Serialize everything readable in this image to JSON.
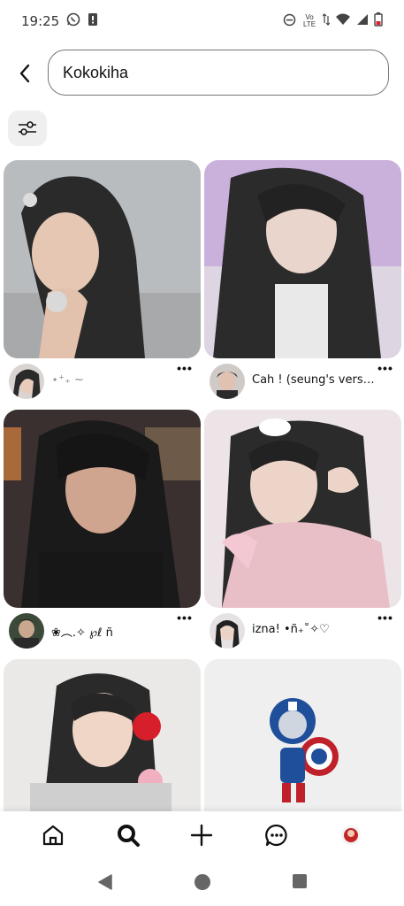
{
  "status_bar": {
    "time": "19:25",
    "network_label": "Vo LTE"
  },
  "search": {
    "value": "Kokokiha"
  },
  "pins": [
    {
      "caption": "⋆⁺₊ ~",
      "colors": [
        "#b7babd",
        "#2b2b2b"
      ]
    },
    {
      "caption": "Cah ! (seung's versio...",
      "colors": [
        "#cbb3dd",
        "#2a2a2a"
      ]
    },
    {
      "caption": "❀︵.✧ ℘ℓ ñ",
      "colors": [
        "#3a3030",
        "#1a1a1a"
      ]
    },
    {
      "caption": "izna! •ñ₊˚✧♡",
      "colors": [
        "#f0e6ea",
        "#2b2b2b"
      ]
    },
    {
      "caption": "",
      "colors": [
        "#e8e6e4",
        "#2a2a2a"
      ]
    },
    {
      "caption": "",
      "colors": [
        "#f0f0f0",
        "#1f4f9a"
      ]
    }
  ],
  "bottom_nav": [
    "home-icon",
    "search-icon",
    "plus-icon",
    "messages-icon",
    "profile-avatar"
  ],
  "system_nav": [
    "back-triangle",
    "home-circle",
    "recents-square"
  ]
}
